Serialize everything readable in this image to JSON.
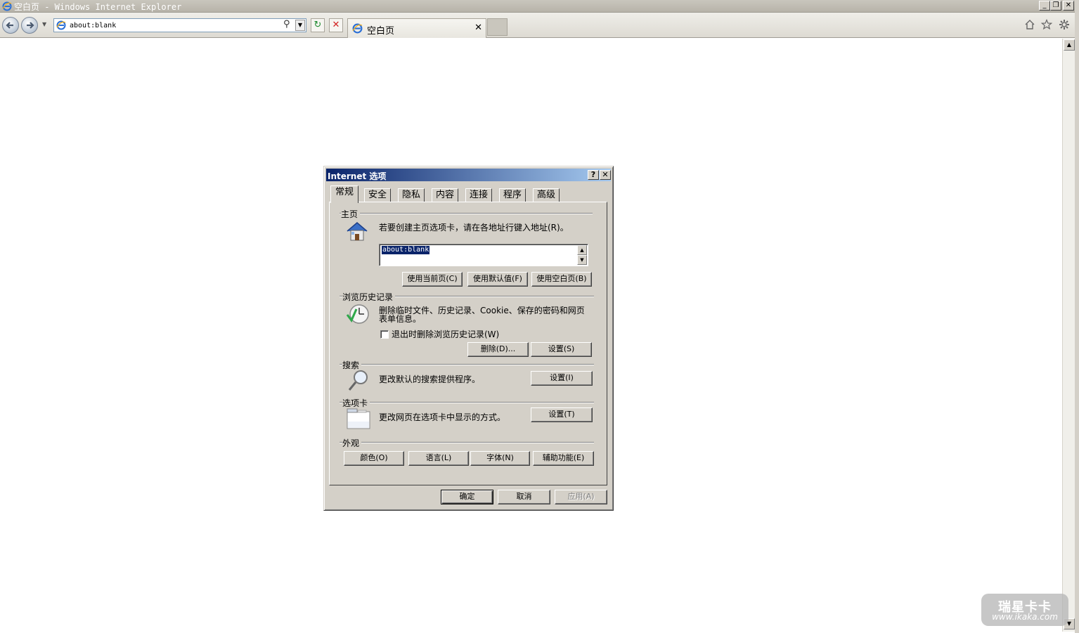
{
  "window": {
    "title": "空白页 - Windows Internet Explorer",
    "minimize_glyph": "_",
    "restore_glyph": "❐",
    "close_glyph": "✕"
  },
  "toolbar": {
    "address_value": "about:blank",
    "search_glyph": "⚲",
    "dropdown_glyph": "▼",
    "refresh_glyph": "↻",
    "stop_glyph": "✕"
  },
  "tabs": {
    "active_label": "空白页",
    "close_glyph": "✕"
  },
  "command_icons": [
    "home-icon",
    "favorites-star-icon",
    "tools-gear-icon"
  ],
  "dialog": {
    "title": "Internet 选项",
    "help_glyph": "?",
    "close_glyph": "✕",
    "tabs": [
      "常规",
      "安全",
      "隐私",
      "内容",
      "连接",
      "程序",
      "高级"
    ],
    "homepage": {
      "group_title": "主页",
      "description": "若要创建主页选项卡，请在各地址行键入地址(R)。",
      "url_value": "about:blank",
      "btn_current": "使用当前页(C)",
      "btn_default": "使用默认值(F)",
      "btn_blank": "使用空白页(B)"
    },
    "history": {
      "group_title": "浏览历史记录",
      "description_line1": "删除临时文件、历史记录、Cookie、保存的密码和网页",
      "description_line2": "表单信息。",
      "checkbox_label": "退出时删除浏览历史记录(W)",
      "checkbox_checked": false,
      "btn_delete": "删除(D)...",
      "btn_settings": "设置(S)"
    },
    "search": {
      "group_title": "搜索",
      "description": "更改默认的搜索提供程序。",
      "btn_settings": "设置(I)"
    },
    "tabs_group": {
      "group_title": "选项卡",
      "description": "更改网页在选项卡中显示的方式。",
      "btn_settings": "设置(T)"
    },
    "appearance": {
      "group_title": "外观",
      "btn_colors": "颜色(O)",
      "btn_languages": "语言(L)",
      "btn_fonts": "字体(N)",
      "btn_accessibility": "辅助功能(E)"
    },
    "footer": {
      "btn_ok": "确定",
      "btn_cancel": "取消",
      "btn_apply": "应用(A)"
    }
  },
  "watermark": {
    "line1": "瑞星卡卡",
    "line2": "www.ikaka.com"
  },
  "colors": {
    "dialog_face": "#d4d0c8",
    "title_gradient_start": "#0a246a",
    "title_gradient_end": "#a6caf0",
    "selection": "#0a246a"
  }
}
